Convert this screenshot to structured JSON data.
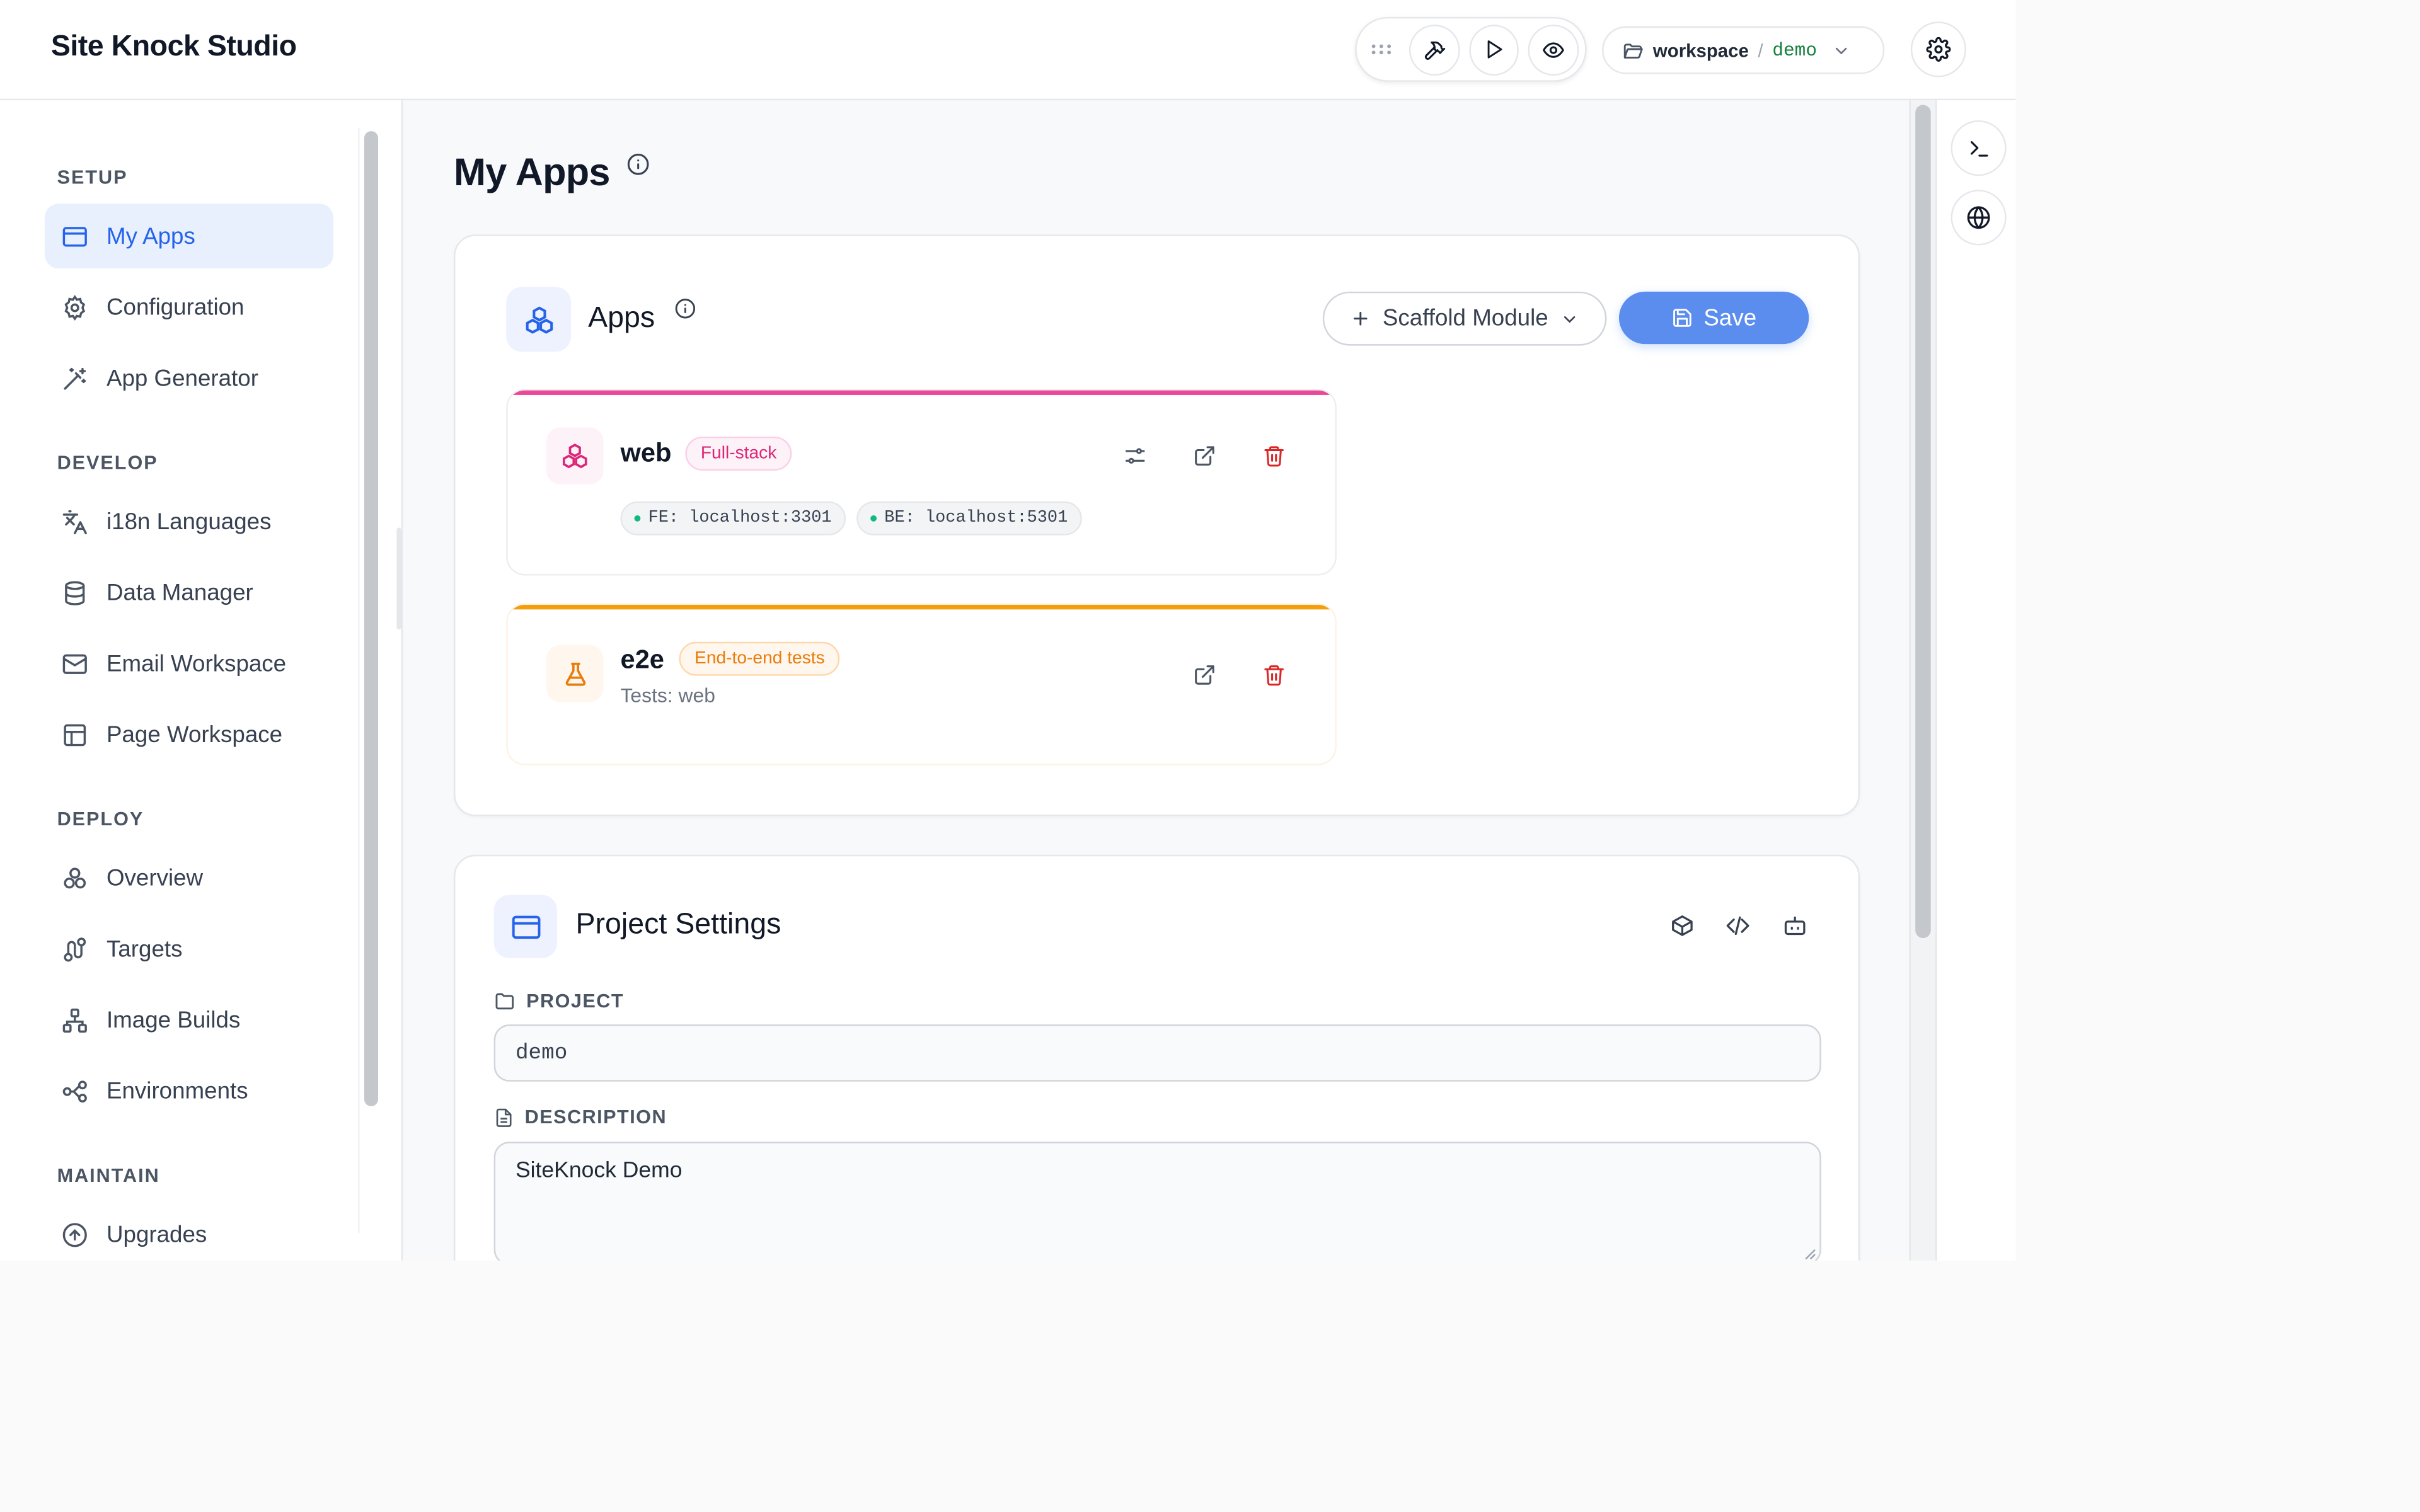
{
  "header": {
    "brand": "Site Knock Studio",
    "workspace_label": "workspace",
    "workspace_separator": "/",
    "workspace_project": "demo"
  },
  "toolbar": {
    "icons": [
      "drag-handle-icon",
      "hammer-icon",
      "play-icon",
      "eye-icon"
    ]
  },
  "sidebar": {
    "sections": [
      {
        "title": "SETUP",
        "items": [
          {
            "label": "My Apps",
            "icon": "app-window-icon",
            "active": true
          },
          {
            "label": "Configuration",
            "icon": "gear-icon"
          },
          {
            "label": "App Generator",
            "icon": "wand-icon"
          }
        ]
      },
      {
        "title": "DEVELOP",
        "items": [
          {
            "label": "i18n Languages",
            "icon": "languages-icon"
          },
          {
            "label": "Data Manager",
            "icon": "database-icon"
          },
          {
            "label": "Email Workspace",
            "icon": "mail-icon"
          },
          {
            "label": "Page Workspace",
            "icon": "layout-icon"
          }
        ]
      },
      {
        "title": "DEPLOY",
        "items": [
          {
            "label": "Overview",
            "icon": "boxes-icon"
          },
          {
            "label": "Targets",
            "icon": "route-icon"
          },
          {
            "label": "Image Builds",
            "icon": "network-icon"
          },
          {
            "label": "Environments",
            "icon": "workflow-icon"
          }
        ]
      },
      {
        "title": "MAINTAIN",
        "items": [
          {
            "label": "Upgrades",
            "icon": "arrow-up-circle-icon"
          }
        ]
      }
    ]
  },
  "main": {
    "page_title": "My Apps",
    "apps_card": {
      "title": "Apps",
      "scaffold_label": "Scaffold Module",
      "save_label": "Save",
      "apps": [
        {
          "name": "web",
          "badge": "Full-stack",
          "accent": "#ec4899",
          "chips": [
            "FE: localhost:3301",
            "BE: localhost:5301"
          ]
        },
        {
          "name": "e2e",
          "badge": "End-to-end tests",
          "accent": "#f59e0b",
          "subtitle": "Tests: web"
        }
      ]
    },
    "settings_card": {
      "title": "Project Settings",
      "project_label": "PROJECT",
      "project_value": "demo",
      "description_label": "DESCRIPTION",
      "description_value": "SiteKnock Demo"
    }
  },
  "colors": {
    "accent_blue": "#2563eb",
    "save_button": "#5b8def",
    "web_accent": "#ec4899",
    "e2e_accent": "#f59e0b",
    "delete_red": "#dc2626"
  }
}
